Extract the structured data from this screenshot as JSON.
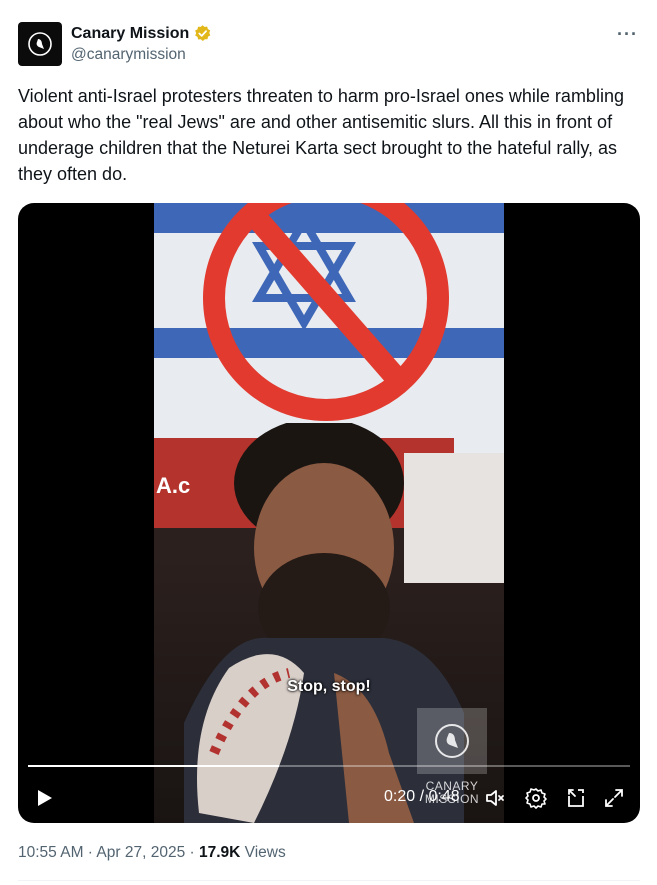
{
  "author": {
    "display_name": "Canary Mission",
    "handle": "@canarymission",
    "verified_badge_color": "#e2b719"
  },
  "more_label": "···",
  "tweet": {
    "text": "Violent anti-Israel protesters threaten to harm pro-Israel ones while rambling about who the \"real Jews\" are and other antisemitic slurs. All this in front of underage children that the Neturei Karta sect brought to the hateful rally, as they often do."
  },
  "video": {
    "banner_text": "A.c",
    "caption": "Stop, stop!",
    "watermark_text": "CANARY MISSION",
    "time_current": "0:20",
    "time_separator": " / ",
    "time_total": "0:48",
    "progress_fraction": 0.4167,
    "icons": [
      "play-icon",
      "mute-icon",
      "settings-icon",
      "picture-in-picture-icon",
      "fullscreen-icon"
    ]
  },
  "meta": {
    "time": "10:55 AM",
    "separator": " · ",
    "date": "Apr 27, 2025",
    "views_count": "17.9K",
    "views_label": "Views"
  },
  "colors": {
    "text_primary": "#0f1419",
    "text_secondary": "#536471",
    "flag_blue": "#3f67b8",
    "no_sign_red": "#e23a2e"
  }
}
